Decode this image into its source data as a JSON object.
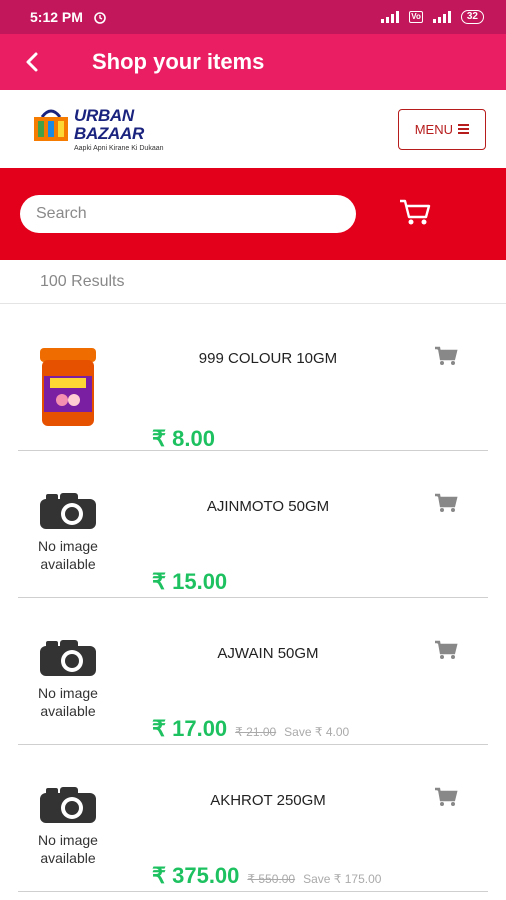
{
  "status": {
    "time": "5:12 PM",
    "battery": "32"
  },
  "header": {
    "title": "Shop your items"
  },
  "brand": {
    "line1": "URBAN",
    "line2": "BAZAAR",
    "tagline": "Aapki Apni Kirane Ki Dukaan",
    "menu_label": "MENU"
  },
  "search": {
    "placeholder": "Search"
  },
  "results": {
    "label": "100 Results"
  },
  "colors": {
    "status_bar": "#c2185b",
    "app_bar": "#e91e63",
    "search_bar": "#e3001b",
    "price": "#1ec160",
    "menu_border": "#b71c1c"
  },
  "products": [
    {
      "name": "999 COLOUR 10GM",
      "price": "₹ 8.00",
      "mrp": "",
      "save": "",
      "image": "product-photo"
    },
    {
      "name": "AJINMOTO 50GM",
      "price": "₹ 15.00",
      "mrp": "",
      "save": "",
      "image": "camera-icon",
      "no_image_1": "No image",
      "no_image_2": "available"
    },
    {
      "name": "AJWAIN 50GM",
      "price": "₹ 17.00",
      "mrp": "₹ 21.00",
      "save": "Save ₹ 4.00",
      "image": "camera-icon",
      "no_image_1": "No image",
      "no_image_2": "available"
    },
    {
      "name": "AKHROT 250GM",
      "price": "₹ 375.00",
      "mrp": "₹ 550.00",
      "save": "Save ₹ 175.00",
      "image": "camera-icon",
      "no_image_1": "No image",
      "no_image_2": "available"
    }
  ]
}
